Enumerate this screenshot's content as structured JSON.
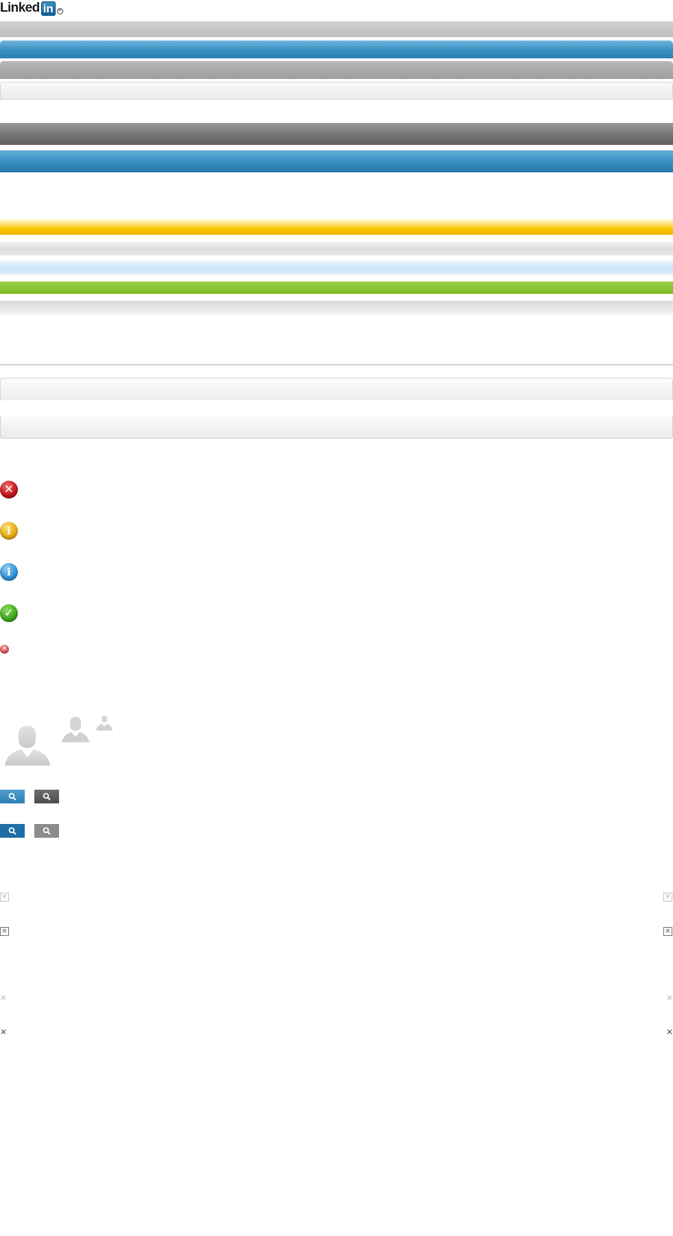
{
  "logo": {
    "text": "Linked",
    "box_text": "in",
    "registered": "®"
  },
  "status_icons": {
    "error": "✕",
    "warning": "i",
    "info": "i",
    "success": "✓",
    "error_small": "✕"
  },
  "close_glyph": "✕",
  "colors": {
    "brand_blue": "#2d7db3",
    "warning_yellow": "#f2b800",
    "success_green": "#7bbb23",
    "error_red": "#c0121b"
  },
  "icons": {
    "search": "magnifier-icon",
    "avatar": "profile-placeholder-icon",
    "close": "close-icon"
  }
}
